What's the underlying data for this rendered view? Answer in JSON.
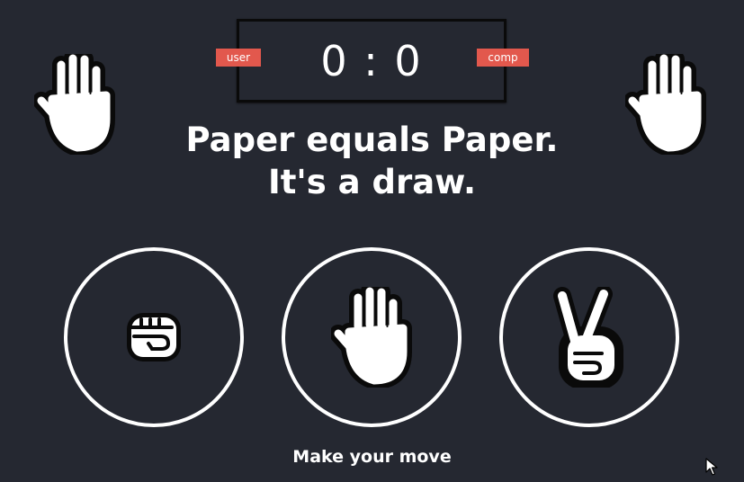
{
  "score": {
    "display": "0 : 0",
    "user": 0,
    "comp": 0,
    "user_label": "user",
    "comp_label": "comp"
  },
  "hands": {
    "user_choice": "paper-hand-icon",
    "comp_choice": "paper-hand-icon"
  },
  "result": {
    "line1": "Paper equals Paper.",
    "line2": "It's a draw."
  },
  "choices": [
    {
      "name": "rock",
      "icon": "fist-icon"
    },
    {
      "name": "paper",
      "icon": "paper-hand-icon"
    },
    {
      "name": "scissors",
      "icon": "scissors-hand-icon"
    }
  ],
  "message": "Make your move",
  "colors": {
    "background": "#252831",
    "badge": "#e2584d",
    "text": "#ffffff"
  }
}
